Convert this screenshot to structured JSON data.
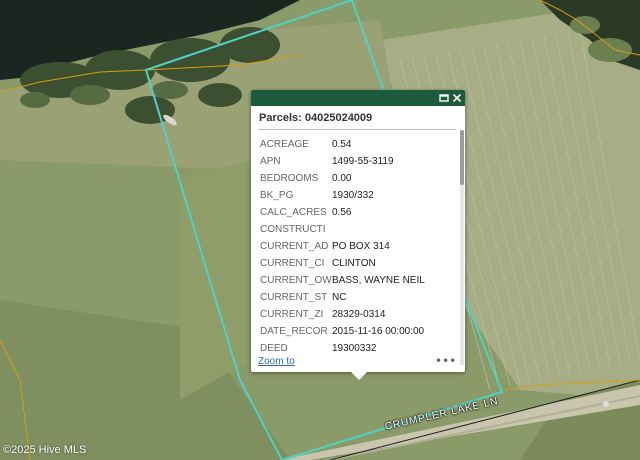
{
  "popup": {
    "title": "Parcels: 04025024009",
    "zoom_label": "Zoom to",
    "more_label": "•••",
    "maximize_icon": "maximize-icon",
    "close_icon": "close-icon",
    "attributes": [
      {
        "key": "ACREAGE",
        "value": "0.54"
      },
      {
        "key": "APN",
        "value": "1499-55-3119"
      },
      {
        "key": "BEDROOMS",
        "value": "0.00"
      },
      {
        "key": "BK_PG",
        "value": "1930/332"
      },
      {
        "key": "CALC_ACRES",
        "value": "0.56"
      },
      {
        "key": "CONSTRUCTI",
        "value": ""
      },
      {
        "key": "CURRENT_AD",
        "value": "PO BOX 314"
      },
      {
        "key": "CURRENT_CI",
        "value": "CLINTON"
      },
      {
        "key": "CURRENT_OW",
        "value": "BASS, WAYNE NEIL"
      },
      {
        "key": "CURRENT_ST",
        "value": "NC"
      },
      {
        "key": "CURRENT_ZI",
        "value": "28329-0314"
      },
      {
        "key": "DATE_RECOR",
        "value": "2015-11-16 00:00:00"
      },
      {
        "key": "DEED",
        "value": "19300332"
      }
    ]
  },
  "map": {
    "road_label": "CRUMPLER LAKE LN",
    "copyright": "©2025 Hive MLS",
    "parcel_color": "#4fd1c5",
    "boundary_color": "#d4a017",
    "header_color": "#1e5a3c"
  }
}
